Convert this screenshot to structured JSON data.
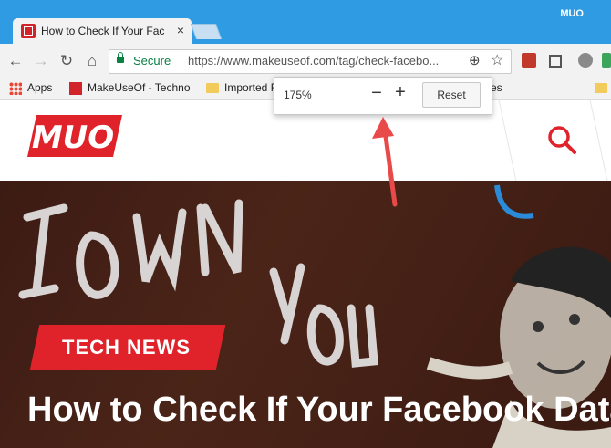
{
  "browser": {
    "profile_name": "MUO",
    "tab": {
      "title": "How to Check If Your Fac",
      "close_icon": "×"
    },
    "toolbar": {
      "back_icon": "←",
      "forward_icon": "→",
      "reload_icon": "↻",
      "home_icon": "⌂",
      "secure_label": "Secure",
      "url": "https://www.makeuseof.com/tag/check-facebo...",
      "zoom_icon": "⊕",
      "star_icon": "☆"
    },
    "bookmarks": [
      {
        "label": "Apps",
        "icon": "apps-grid-icon"
      },
      {
        "label": "MakeUseOf - Technology, Simplified",
        "display": "MakeUseOf - Techno",
        "icon": "muo-favicon"
      },
      {
        "label": "Imported From",
        "display": "Imported F",
        "icon": "folder-icon"
      },
      {
        "label": "es",
        "display": "es",
        "icon": "folder-icon"
      }
    ]
  },
  "zoom_popup": {
    "level": "175%",
    "minus": "−",
    "plus": "+",
    "reset_label": "Reset"
  },
  "page": {
    "logo_text": "MUO",
    "tag": "TECH NEWS",
    "headline": "How to Check If Your Facebook Data Was Sold Off"
  },
  "colors": {
    "titlebar": "#2f9be3",
    "brand_red": "#e0232a",
    "secure_green": "#0a8043"
  }
}
